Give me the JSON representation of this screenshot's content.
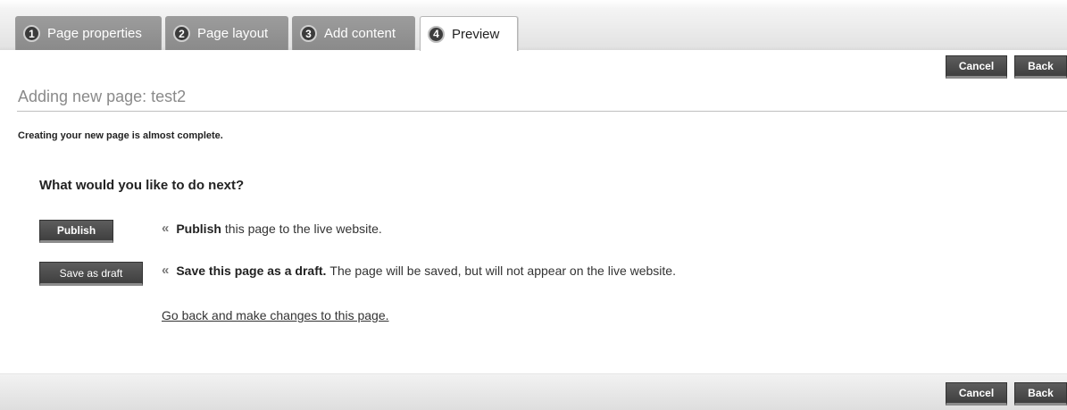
{
  "tabs": [
    {
      "number": "1",
      "label": "Page properties"
    },
    {
      "number": "2",
      "label": "Page layout"
    },
    {
      "number": "3",
      "label": "Add content"
    },
    {
      "number": "4",
      "label": "Preview",
      "active": true
    }
  ],
  "toolbar": {
    "cancel_label": "Cancel",
    "back_label": "Back"
  },
  "page_title": "Adding new page: test2",
  "intro_text": "Creating your new page is almost complete.",
  "question": "What would you like to do next?",
  "options": {
    "publish": {
      "button_label": "Publish",
      "marker": "«",
      "bold_text": "Publish",
      "text": "this page to the live website."
    },
    "draft": {
      "button_label": "Save as draft",
      "marker": "«",
      "bold_text": "Save this page as a draft.",
      "text": "The page will be saved, but will not appear on the live website."
    }
  },
  "back_link": "Go back and make changes to this page.",
  "colors": {
    "button": "#4a4a4a",
    "tab_inactive": "#939393",
    "title_gray": "#8a8a8a"
  }
}
